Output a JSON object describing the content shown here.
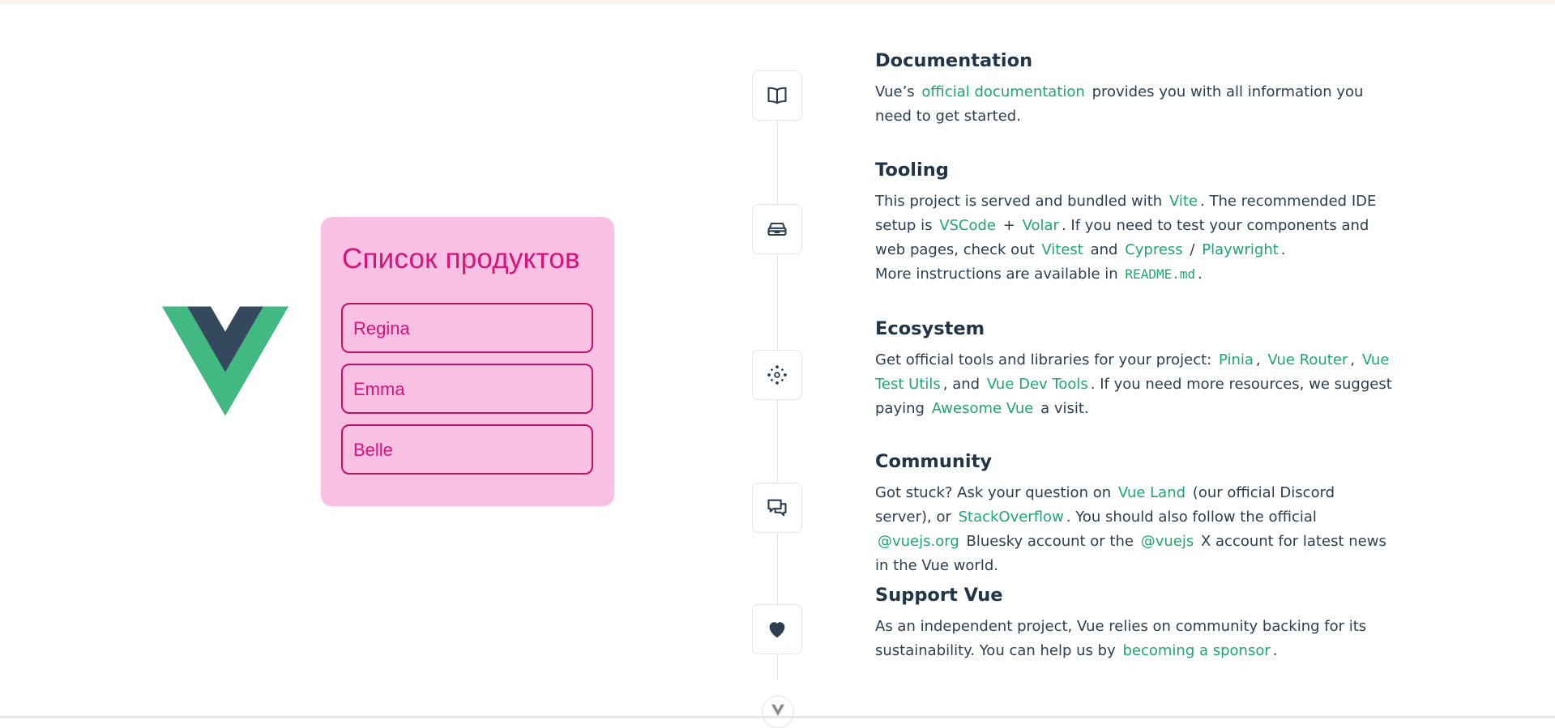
{
  "product_list": {
    "title": "Список продуктов",
    "items": [
      "Regina",
      "Emma",
      "Belle"
    ]
  },
  "colors": {
    "vue_green": "#42b883",
    "vue_dark": "#35495e",
    "card_bg": "#f8c0e3",
    "card_text": "#d8137a",
    "link": "#1ea672"
  },
  "icons": [
    "documentation-icon",
    "tooling-icon",
    "ecosystem-icon",
    "community-icon",
    "support-icon",
    "scroll-down-icon"
  ],
  "documentation": {
    "title": "Documentation",
    "t1": "Vue’s",
    "link1": "official documentation",
    "t2": "provides you with all information you need to get started."
  },
  "tooling": {
    "title": "Tooling",
    "t1": "This project is served and bundled with",
    "vite": "Vite",
    "t2": ". The recommended IDE setup is",
    "vscode": "VSCode",
    "plus": "+",
    "volar": "Volar",
    "t3": ". If you need to test your components and web pages, check out",
    "vitest": "Vitest",
    "and": "and",
    "cypress": "Cypress",
    "slash": "/",
    "playwright": "Playwright",
    "t4": ".",
    "t5": "More instructions are available in",
    "readme": "README.md",
    "t6": "."
  },
  "ecosystem": {
    "title": "Ecosystem",
    "t1": "Get official tools and libraries for your project:",
    "pinia": "Pinia",
    "comma1": ",",
    "router": "Vue Router",
    "comma2": ",",
    "testutils": "Vue Test Utils",
    "t2": ", and",
    "devtools": "Vue Dev Tools",
    "t3": ". If you need more resources, we suggest paying",
    "awesome": "Awesome Vue",
    "t4": "a visit."
  },
  "community": {
    "title": "Community",
    "t1": "Got stuck? Ask your question on",
    "vueland": "Vue Land",
    "t2": "(our official Discord server), or",
    "stackoverflow": "StackOverflow",
    "t3": ". You should also follow the official",
    "vuejsorg": "@vuejs.org",
    "t4": "Bluesky account or the",
    "vuejs": "@vuejs",
    "t5": "X account for latest news in the Vue world."
  },
  "support": {
    "title": "Support Vue",
    "t1": "As an independent project, Vue relies on community backing for its sustainability. You can help us by",
    "sponsor": "becoming a sponsor",
    "t2": "."
  }
}
